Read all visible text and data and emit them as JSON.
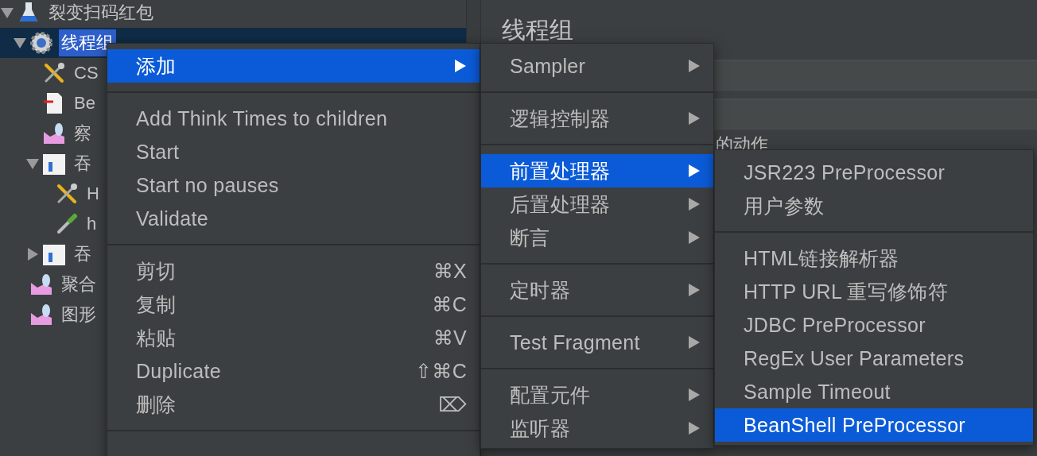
{
  "tree": {
    "items": [
      {
        "label": "裂变扫码红包",
        "kind": "plan",
        "expanded": true,
        "selected": false,
        "children": [
          {
            "label": "线程组",
            "kind": "thread-group",
            "expanded": true,
            "selected": true,
            "children": [
              {
                "label": "CS",
                "kind": "config",
                "selected": false
              },
              {
                "label": "Be",
                "kind": "script",
                "selected": false
              },
              {
                "label": "察",
                "kind": "listener",
                "selected": false
              },
              {
                "label": "吞",
                "kind": "controller",
                "expanded": true,
                "selected": false,
                "children": [
                  {
                    "label": "H",
                    "kind": "config",
                    "selected": false
                  },
                  {
                    "label": "h",
                    "kind": "extractor",
                    "selected": false
                  }
                ]
              },
              {
                "label": "吞",
                "kind": "controller",
                "expanded": false,
                "selected": false
              }
            ]
          },
          {
            "label": "聚合",
            "kind": "listener",
            "selected": false
          },
          {
            "label": "图形",
            "kind": "listener",
            "selected": false
          }
        ]
      }
    ]
  },
  "panel": {
    "title": "线程组",
    "group_label": "的动作"
  },
  "context_menu": {
    "items": [
      {
        "kind": "item",
        "label": "添加",
        "submenu": true,
        "selected": true
      },
      {
        "kind": "separator"
      },
      {
        "kind": "item",
        "label": "Add Think Times to children",
        "submenu": false,
        "selected": false
      },
      {
        "kind": "item",
        "label": "Start",
        "submenu": false,
        "selected": false
      },
      {
        "kind": "item",
        "label": "Start no pauses",
        "submenu": false,
        "selected": false
      },
      {
        "kind": "item",
        "label": "Validate",
        "submenu": false,
        "selected": false
      },
      {
        "kind": "separator"
      },
      {
        "kind": "item",
        "label": "剪切",
        "shortcut": "⌘X",
        "submenu": false,
        "selected": false
      },
      {
        "kind": "item",
        "label": "复制",
        "shortcut": "⌘C",
        "submenu": false,
        "selected": false
      },
      {
        "kind": "item",
        "label": "粘贴",
        "shortcut": "⌘V",
        "submenu": false,
        "selected": false
      },
      {
        "kind": "item",
        "label": "Duplicate",
        "shortcut": "⇧⌘C",
        "submenu": false,
        "selected": false
      },
      {
        "kind": "item",
        "label": "删除",
        "shortcut": "⌦",
        "submenu": false,
        "selected": false
      },
      {
        "kind": "separator"
      }
    ]
  },
  "submenu": {
    "items": [
      {
        "kind": "item",
        "label": "Sampler",
        "submenu": true,
        "selected": false
      },
      {
        "kind": "separator"
      },
      {
        "kind": "item",
        "label": "逻辑控制器",
        "submenu": true,
        "selected": false
      },
      {
        "kind": "separator"
      },
      {
        "kind": "item",
        "label": "前置处理器",
        "submenu": true,
        "selected": true
      },
      {
        "kind": "item",
        "label": "后置处理器",
        "submenu": true,
        "selected": false
      },
      {
        "kind": "item",
        "label": "断言",
        "submenu": true,
        "selected": false
      },
      {
        "kind": "separator"
      },
      {
        "kind": "item",
        "label": "定时器",
        "submenu": true,
        "selected": false
      },
      {
        "kind": "separator"
      },
      {
        "kind": "item",
        "label": "Test Fragment",
        "submenu": true,
        "selected": false
      },
      {
        "kind": "separator"
      },
      {
        "kind": "item",
        "label": "配置元件",
        "submenu": true,
        "selected": false
      },
      {
        "kind": "item",
        "label": "监听器",
        "submenu": true,
        "selected": false
      }
    ]
  },
  "submenu_2": {
    "items": [
      {
        "kind": "item",
        "label": "JSR223 PreProcessor",
        "selected": false
      },
      {
        "kind": "item",
        "label": "用户参数",
        "selected": false
      },
      {
        "kind": "separator"
      },
      {
        "kind": "item",
        "label": "HTML链接解析器",
        "selected": false
      },
      {
        "kind": "item",
        "label": "HTTP URL 重写修饰符",
        "selected": false
      },
      {
        "kind": "item",
        "label": "JDBC PreProcessor",
        "selected": false
      },
      {
        "kind": "item",
        "label": "RegEx User Parameters",
        "selected": false
      },
      {
        "kind": "item",
        "label": "Sample Timeout",
        "selected": false
      },
      {
        "kind": "item",
        "label": "BeanShell PreProcessor",
        "selected": true
      }
    ]
  }
}
